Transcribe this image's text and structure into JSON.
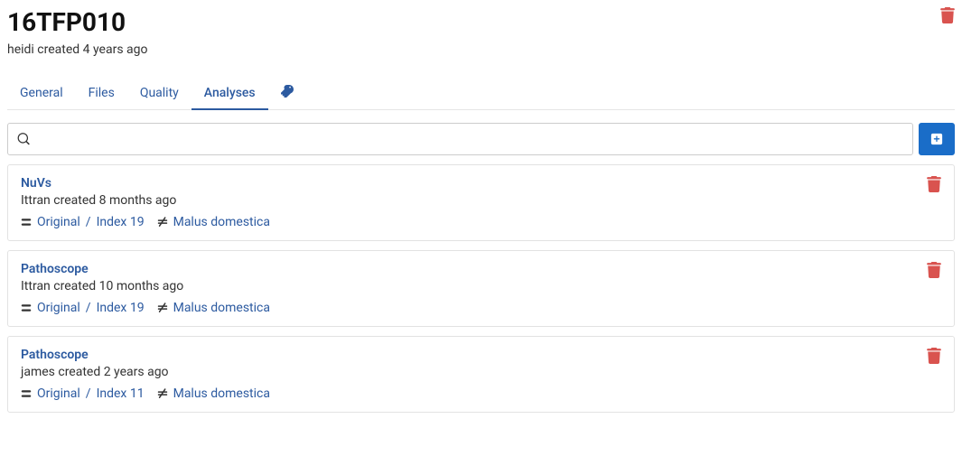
{
  "header": {
    "title": "16TFP010",
    "subtitle": "heidi created 4 years ago"
  },
  "tabs": {
    "general": "General",
    "files": "Files",
    "quality": "Quality",
    "analyses": "Analyses"
  },
  "search": {
    "placeholder": ""
  },
  "analyses": [
    {
      "title": "NuVs",
      "meta": "Ittran created 8 months ago",
      "ref": "Original",
      "index": "Index 19",
      "subtraction": "Malus domestica"
    },
    {
      "title": "Pathoscope",
      "meta": "Ittran created 10 months ago",
      "ref": "Original",
      "index": "Index 19",
      "subtraction": "Malus domestica"
    },
    {
      "title": "Pathoscope",
      "meta": "james created 2 years ago",
      "ref": "Original",
      "index": "Index 11",
      "subtraction": "Malus domestica"
    }
  ]
}
